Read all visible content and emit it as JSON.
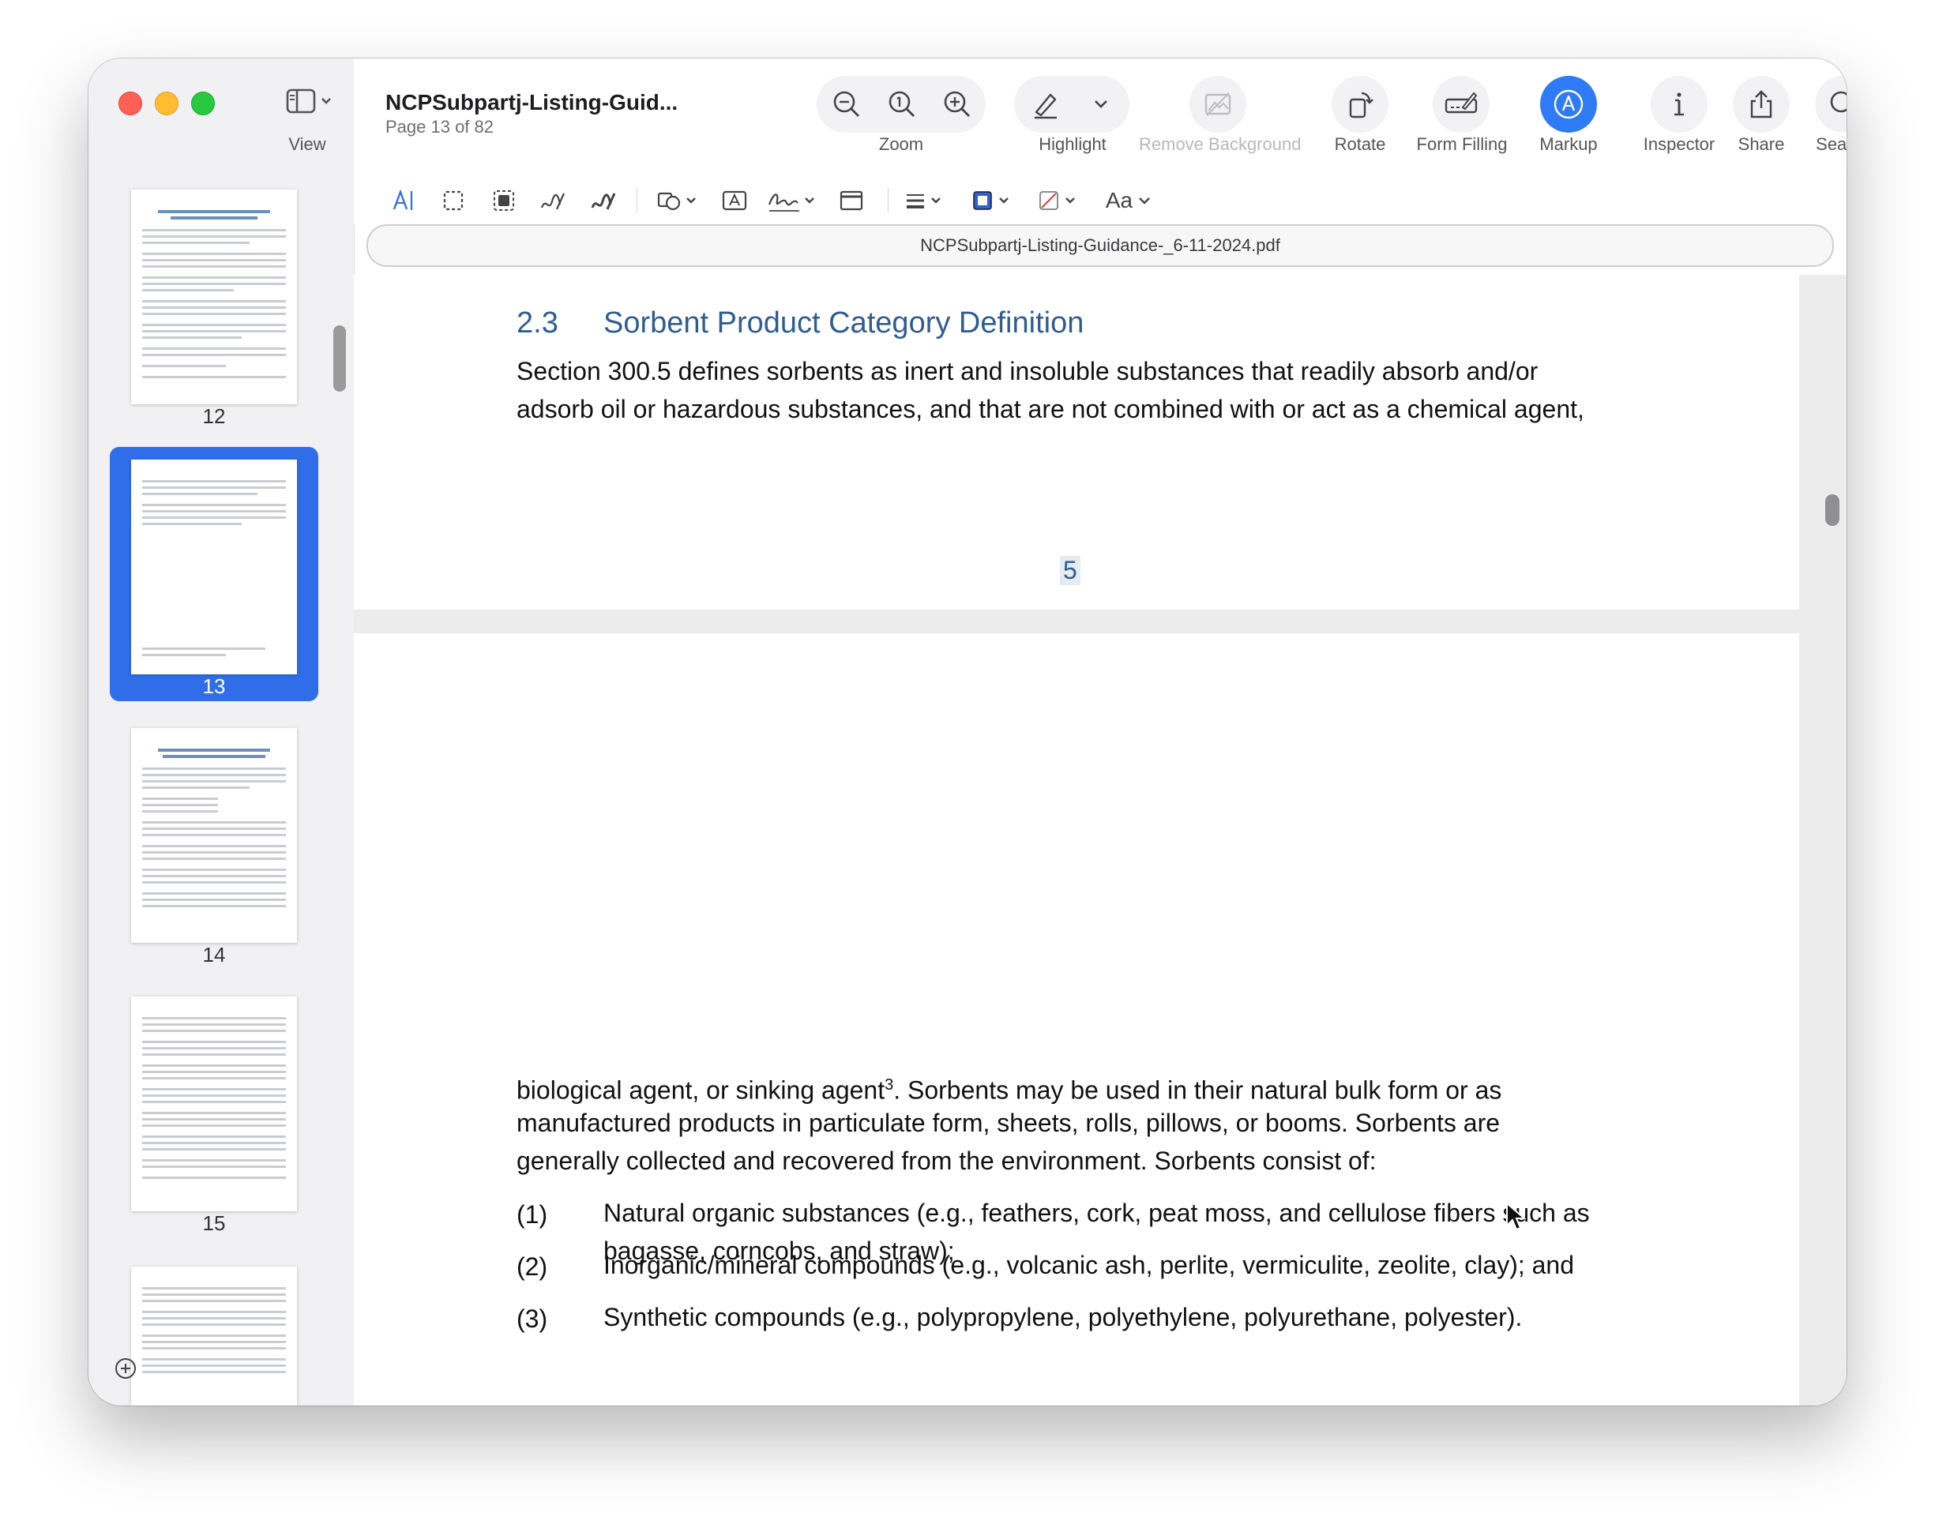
{
  "window": {
    "title": "NCPSubpartj-Listing-Guid...",
    "subtitle": "Page 13 of 82"
  },
  "sidebar": {
    "view_label": "View",
    "thumbnails": [
      {
        "page": "12"
      },
      {
        "page": "13",
        "selected": true
      },
      {
        "page": "14"
      },
      {
        "page": "15"
      }
    ]
  },
  "toolbar": {
    "zoom_label": "Zoom",
    "highlight_label": "Highlight",
    "remove_background_label": "Remove Background",
    "rotate_label": "Rotate",
    "form_filling_label": "Form Filling",
    "markup_label": "Markup",
    "inspector_label": "Inspector",
    "share_label": "Share",
    "search_label": "Search"
  },
  "markup_bar": {
    "font_label": "Aa"
  },
  "file_field": {
    "filename": "NCPSubpartj-Listing-Guidance-_6-11-2024.pdf"
  },
  "document": {
    "section_number": "2.3",
    "section_title": "Sorbent Product Category Definition",
    "top_lines": [
      "Section 300.5 defines sorbents as inert and insoluble substances that readily absorb and/or",
      "adsorb oil or hazardous substances, and that are not combined with or act as a chemical agent,"
    ],
    "page_number": "5",
    "para_line1_before": "biological agent, or sinking agent",
    "footnote_ref": "3",
    "para_line1_after": ". Sorbents may be used in their natural bulk form or as",
    "para_lines": [
      "manufactured products in particulate form, sheets, rolls, pillows, or booms. Sorbents are",
      "generally collected and recovered from the environment. Sorbents consist of:"
    ],
    "list": [
      {
        "num": "(1)",
        "lines": [
          "Natural organic substances (e.g., feathers, cork, peat moss, and cellulose fibers such as",
          "bagasse, corncobs, and straw);"
        ]
      },
      {
        "num": "(2)",
        "lines": [
          "Inorganic/mineral compounds (e.g., volcanic ash, perlite, vermiculite, zeolite, clay); and"
        ]
      },
      {
        "num": "(3)",
        "lines": [
          "Synthetic compounds (e.g., polypropylene, polyethylene, polyurethane, polyester)."
        ]
      }
    ]
  },
  "colors": {
    "accent": "#2f6ee8",
    "heading_blue": "#2f5d92"
  }
}
